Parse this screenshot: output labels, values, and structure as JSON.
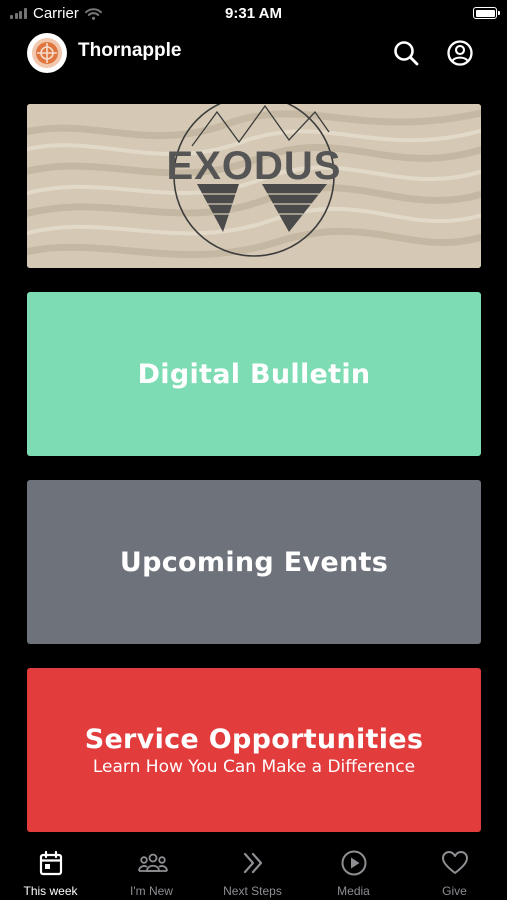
{
  "status_bar": {
    "carrier": "Carrier",
    "time": "9:31 AM"
  },
  "header": {
    "title": "Thornapple",
    "logo_icon": "target-logo-icon",
    "search_icon": "search-icon",
    "profile_icon": "user-circle-icon"
  },
  "hero": {
    "text": "EXODUS",
    "background": "#d5c9b5"
  },
  "cards": [
    {
      "title": "Digital Bulletin",
      "color": "#7ddcb3"
    },
    {
      "title": "Upcoming Events",
      "color": "#6e727b"
    },
    {
      "title": "Service Opportunities",
      "subtitle": "Learn How You Can Make a Difference",
      "color": "#e23c3c"
    }
  ],
  "tabs": [
    {
      "label": "This week",
      "icon": "calendar-icon",
      "active": true
    },
    {
      "label": "I'm New",
      "icon": "people-icon",
      "active": false
    },
    {
      "label": "Next Steps",
      "icon": "double-chevron-icon",
      "active": false
    },
    {
      "label": "Media",
      "icon": "play-circle-icon",
      "active": false
    },
    {
      "label": "Give",
      "icon": "heart-icon",
      "active": false
    }
  ],
  "colors": {
    "accent_logo": "#e0763f",
    "tab_active": "#ffffff",
    "tab_inactive": "#8e8e93"
  }
}
